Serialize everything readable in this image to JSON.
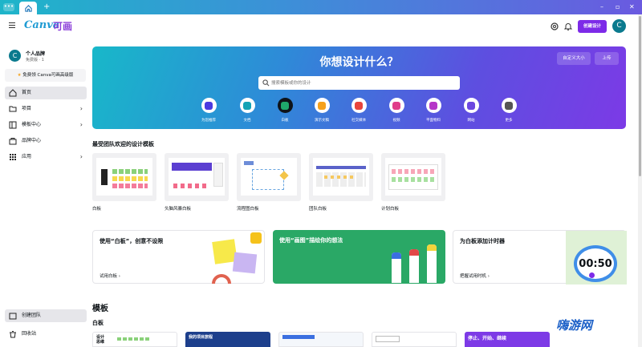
{
  "window": {
    "menu_dots": "•••",
    "new_tab": "+",
    "minimize": "–",
    "maximize": "▫",
    "close": "✕"
  },
  "header": {
    "logo": "Canva",
    "logo_cn": "可画",
    "create_button": "创建设计",
    "avatar_initial": "C"
  },
  "sidebar": {
    "avatar_initial": "C",
    "account_name": "个人品牌",
    "account_sub": "免费版 · 1",
    "trial_label": "免费领 Canva可画高级版",
    "items": [
      {
        "label": "首页",
        "active": true
      },
      {
        "label": "项目",
        "chevron": "›"
      },
      {
        "label": "模板中心",
        "chevron": "›"
      },
      {
        "label": "品牌中心"
      },
      {
        "label": "应用",
        "chevron": "›"
      }
    ],
    "create_team": "创建团队",
    "trash": "回收站"
  },
  "hero": {
    "title": "你想设计什么？",
    "custom_size": "自定义大小",
    "upload": "上传",
    "search_placeholder": "搜索模板或你的设计",
    "categories": [
      {
        "label": "为您推荐",
        "color": "#4b3ae0"
      },
      {
        "label": "文档",
        "color": "#13a3b5"
      },
      {
        "label": "白板",
        "color": "#1fa86b"
      },
      {
        "label": "演示文稿",
        "color": "#f5a11c"
      },
      {
        "label": "社交媒体",
        "color": "#e8443c"
      },
      {
        "label": "视频",
        "color": "#e03c8a"
      },
      {
        "label": "平面物料",
        "color": "#b536c8"
      },
      {
        "label": "网站",
        "color": "#6c47e0"
      },
      {
        "label": "更多",
        "color": "#555555"
      }
    ]
  },
  "popular": {
    "title": "最受团队欢迎的设计模板",
    "items": [
      "白板",
      "头脑风暴白板",
      "流程图白板",
      "团队白板",
      "计划白板"
    ]
  },
  "promos": [
    {
      "title": "使用“白板”，创意不设限",
      "link": "试用白板 ›",
      "bg": "#ffffff"
    },
    {
      "title": "使用“画图”描绘你的想法",
      "link": "",
      "bg": "#2aa866"
    },
    {
      "title": "为白板添加计时器",
      "link": "把握试用时机 ›",
      "bg": "#ffffff",
      "timer": "00:50"
    }
  ],
  "templates": {
    "title": "模板",
    "subtitle": "白板",
    "card_texts": [
      "设计思维",
      "我的项目旅程",
      "",
      "",
      "停止、开始、继续"
    ]
  },
  "watermark": "嗨游网"
}
